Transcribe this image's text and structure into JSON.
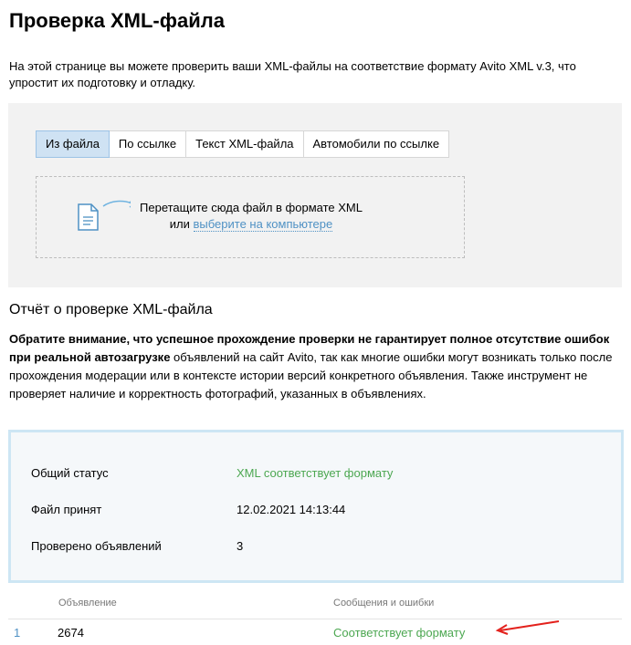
{
  "page": {
    "title": "Проверка XML-файла",
    "intro": "На этой странице вы можете проверить ваши XML-файлы на соответствие формату Avito XML v.3, что упростит их подготовку и отладку."
  },
  "tabs": [
    {
      "label": "Из файла",
      "active": true
    },
    {
      "label": "По ссылке",
      "active": false
    },
    {
      "label": "Текст XML-файла",
      "active": false
    },
    {
      "label": "Автомобили по ссылке",
      "active": false
    }
  ],
  "dropzone": {
    "line1": "Перетащите сюда файл в формате XML",
    "or": "или",
    "link": "выберите на компьютере",
    "icon": "file-document-icon"
  },
  "report": {
    "title": "Отчёт о проверке XML-файла",
    "warning_bold": "Обратите внимание, что успешное прохождение проверки не гарантирует полное отсутствие ошибок при реальной автозагрузке",
    "warning_rest": " объявлений на сайт Avito, так как многие ошибки могут возникать только после прохождения модерации или в контексте истории версий конкретного объявления. Также инструмент не проверяет наличие и корректность фотографий, указанных в объявлениях."
  },
  "status": {
    "rows": [
      {
        "label": "Общий статус",
        "value": "XML соответствует формату"
      },
      {
        "label": "Файл принят",
        "value": "12.02.2021 14:13:44"
      },
      {
        "label": "Проверено объявлений",
        "value": "3"
      }
    ]
  },
  "results": {
    "columns": [
      "Объявление",
      "Сообщения и ошибки"
    ],
    "rows": [
      {
        "index": "1",
        "ad": "2674",
        "message": "Соответствует формату"
      }
    ]
  },
  "colors": {
    "accent_blue": "#4f91c4",
    "success_green": "#4ca751",
    "annotation_red": "#e3211c"
  }
}
